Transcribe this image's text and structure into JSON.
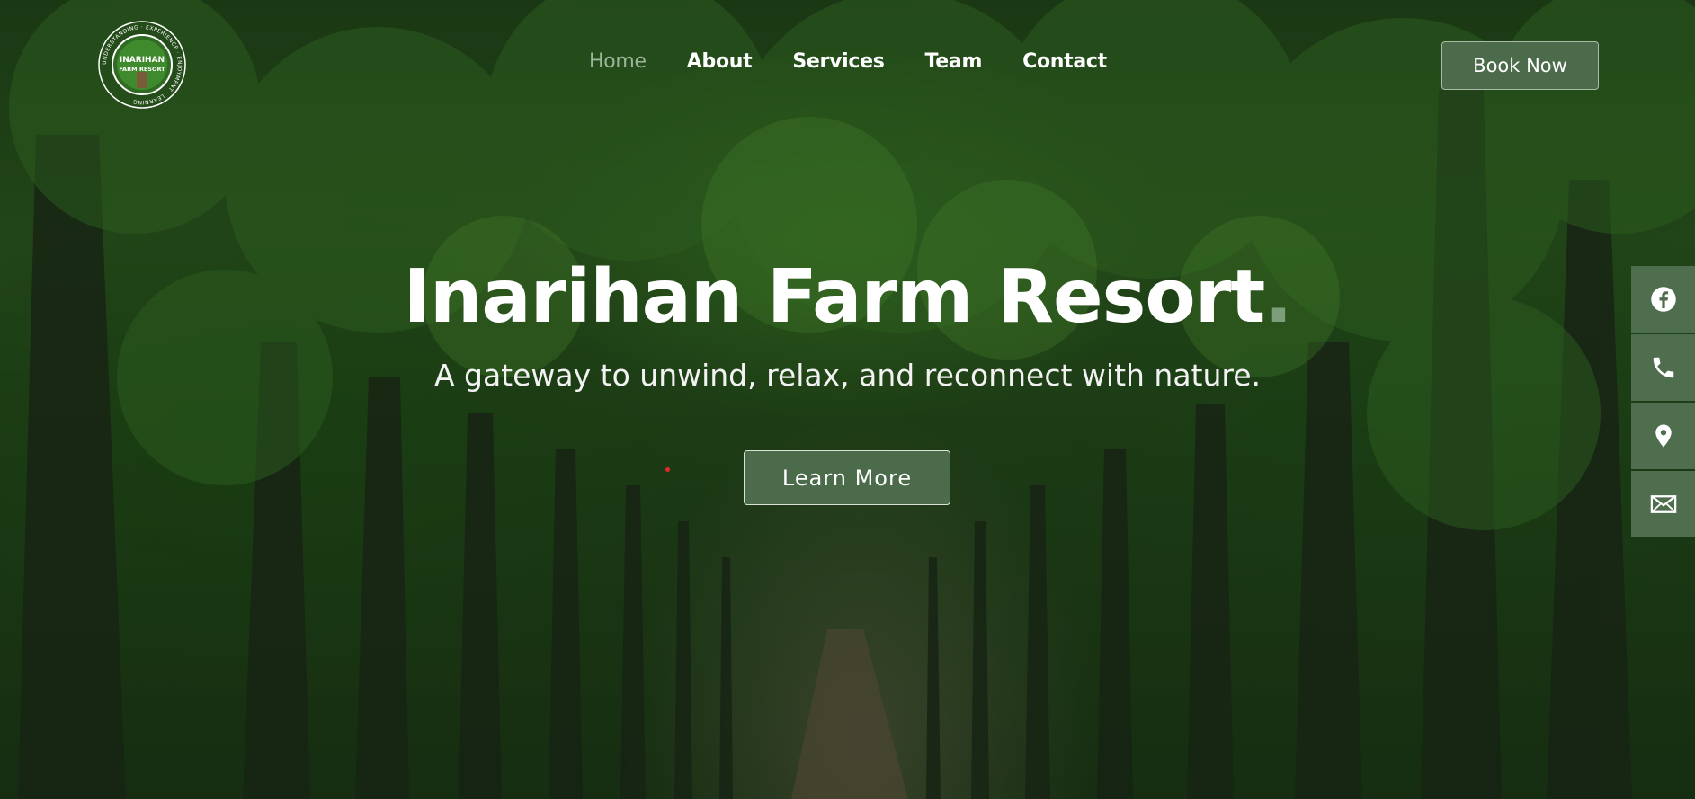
{
  "header": {
    "logo": {
      "title": "INARIHAN",
      "subtitle": "FARM RESORT",
      "ring_text": "UNDERSTANDING · EXPERIENCE · ENJOYMENT · LEARNING"
    },
    "nav": [
      {
        "label": "Home",
        "active": true
      },
      {
        "label": "About",
        "active": false
      },
      {
        "label": "Services",
        "active": false
      },
      {
        "label": "Team",
        "active": false
      },
      {
        "label": "Contact",
        "active": false
      }
    ],
    "book_button": "Book Now"
  },
  "hero": {
    "title": "Inarihan Farm Resort",
    "title_dot": ".",
    "subtitle": "A gateway to unwind, relax, and reconnect with nature.",
    "cta": "Learn More"
  },
  "social": [
    {
      "icon": "facebook-icon"
    },
    {
      "icon": "phone-icon"
    },
    {
      "icon": "location-pin-icon"
    },
    {
      "icon": "mail-icon"
    }
  ],
  "colors": {
    "accent": "#4b6b4a",
    "nav_active": "#9db59a",
    "title_dot": "#7d9e7a",
    "sidebar": "#4f6e4d"
  }
}
